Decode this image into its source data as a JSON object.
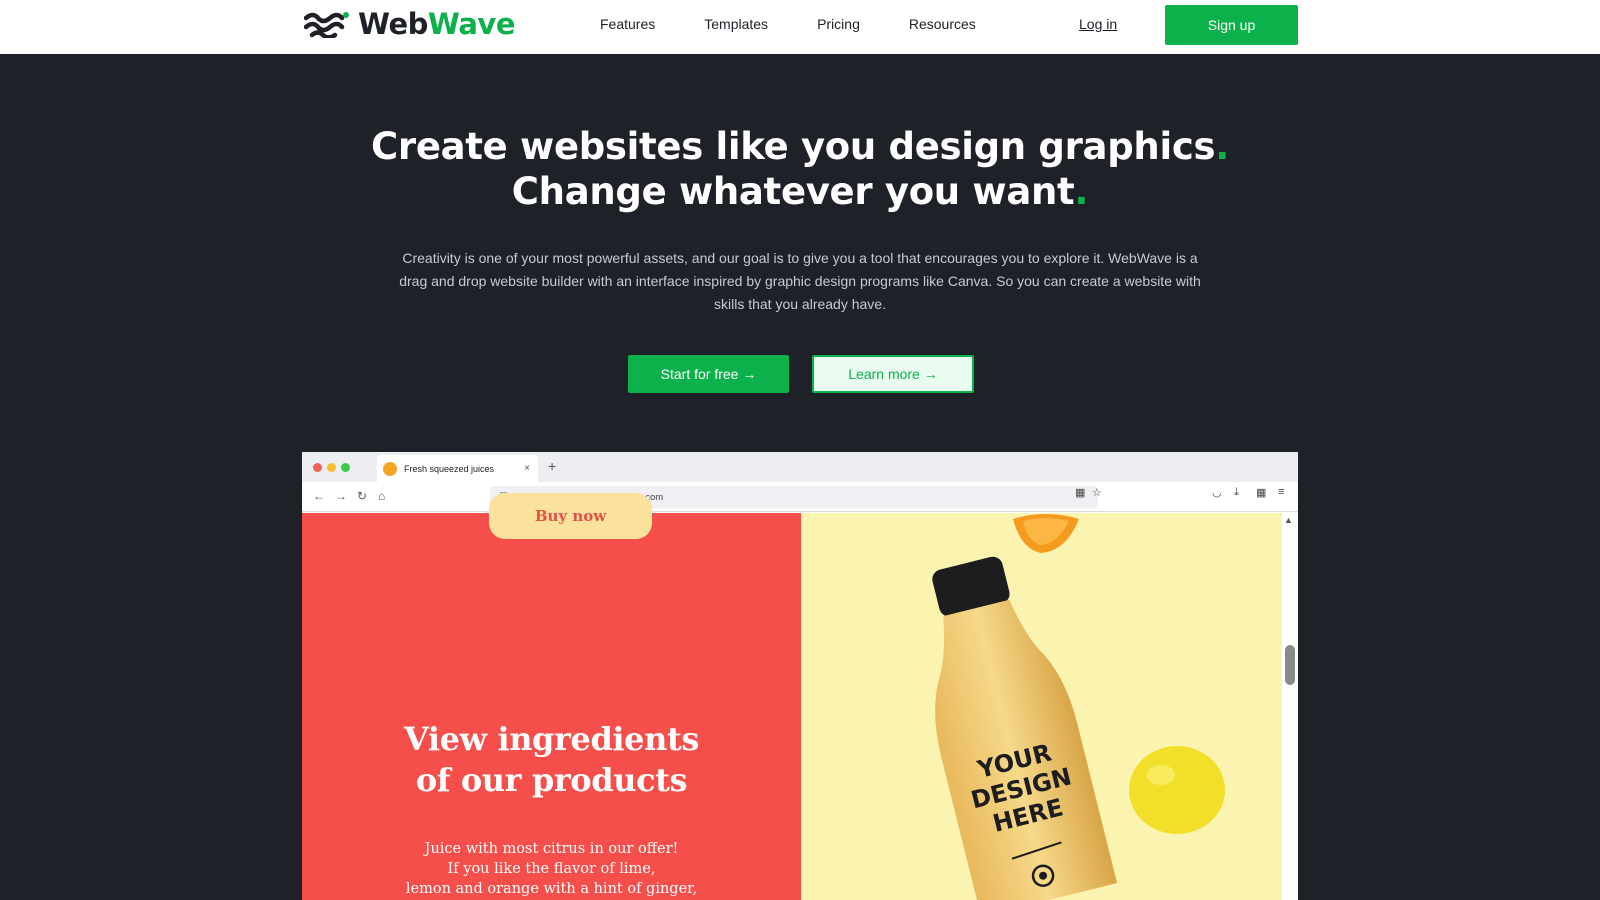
{
  "header": {
    "logo_web": "Web",
    "logo_wave": "Wave",
    "nav": [
      "Features",
      "Templates",
      "Pricing",
      "Resources"
    ],
    "login_label": "Log in",
    "signup_label": "Sign up"
  },
  "hero": {
    "title_line1": "Create websites like you design graphics",
    "title_line2": "Change whatever you want",
    "title_dot": ".",
    "description": "Creativity is one of your most powerful assets, and our goal is to give you a tool that encourages you to explore it. WebWave is a drag and drop website builder with an interface inspired by graphic design programs like Canva. So you can create a website with skills that you already have.",
    "start_button": "Start for free →",
    "learn_button": "Learn more →"
  },
  "browser": {
    "tab_title": "Fresh squeezed juices",
    "tab_close": "×",
    "new_tab": "+",
    "url": "https:// freshsqueezedjuices.com"
  },
  "site": {
    "buy_button": "Buy now",
    "heading_line1": "View ingredients",
    "heading_line2": "of our products",
    "body_line1": "Juice with most citrus in our offer!",
    "body_line2": "If you like the flavor of lime,",
    "body_line3": "lemon and orange with a hint of ginger,",
    "bottle_label_line1": "YOUR",
    "bottle_label_line2": "DESIGN",
    "bottle_label_line3": "HERE"
  },
  "colors": {
    "brand_green": "#0db14b",
    "hero_bg": "#1f2129",
    "site_red": "#f64e4a",
    "site_yellow": "#fbf3b0"
  }
}
